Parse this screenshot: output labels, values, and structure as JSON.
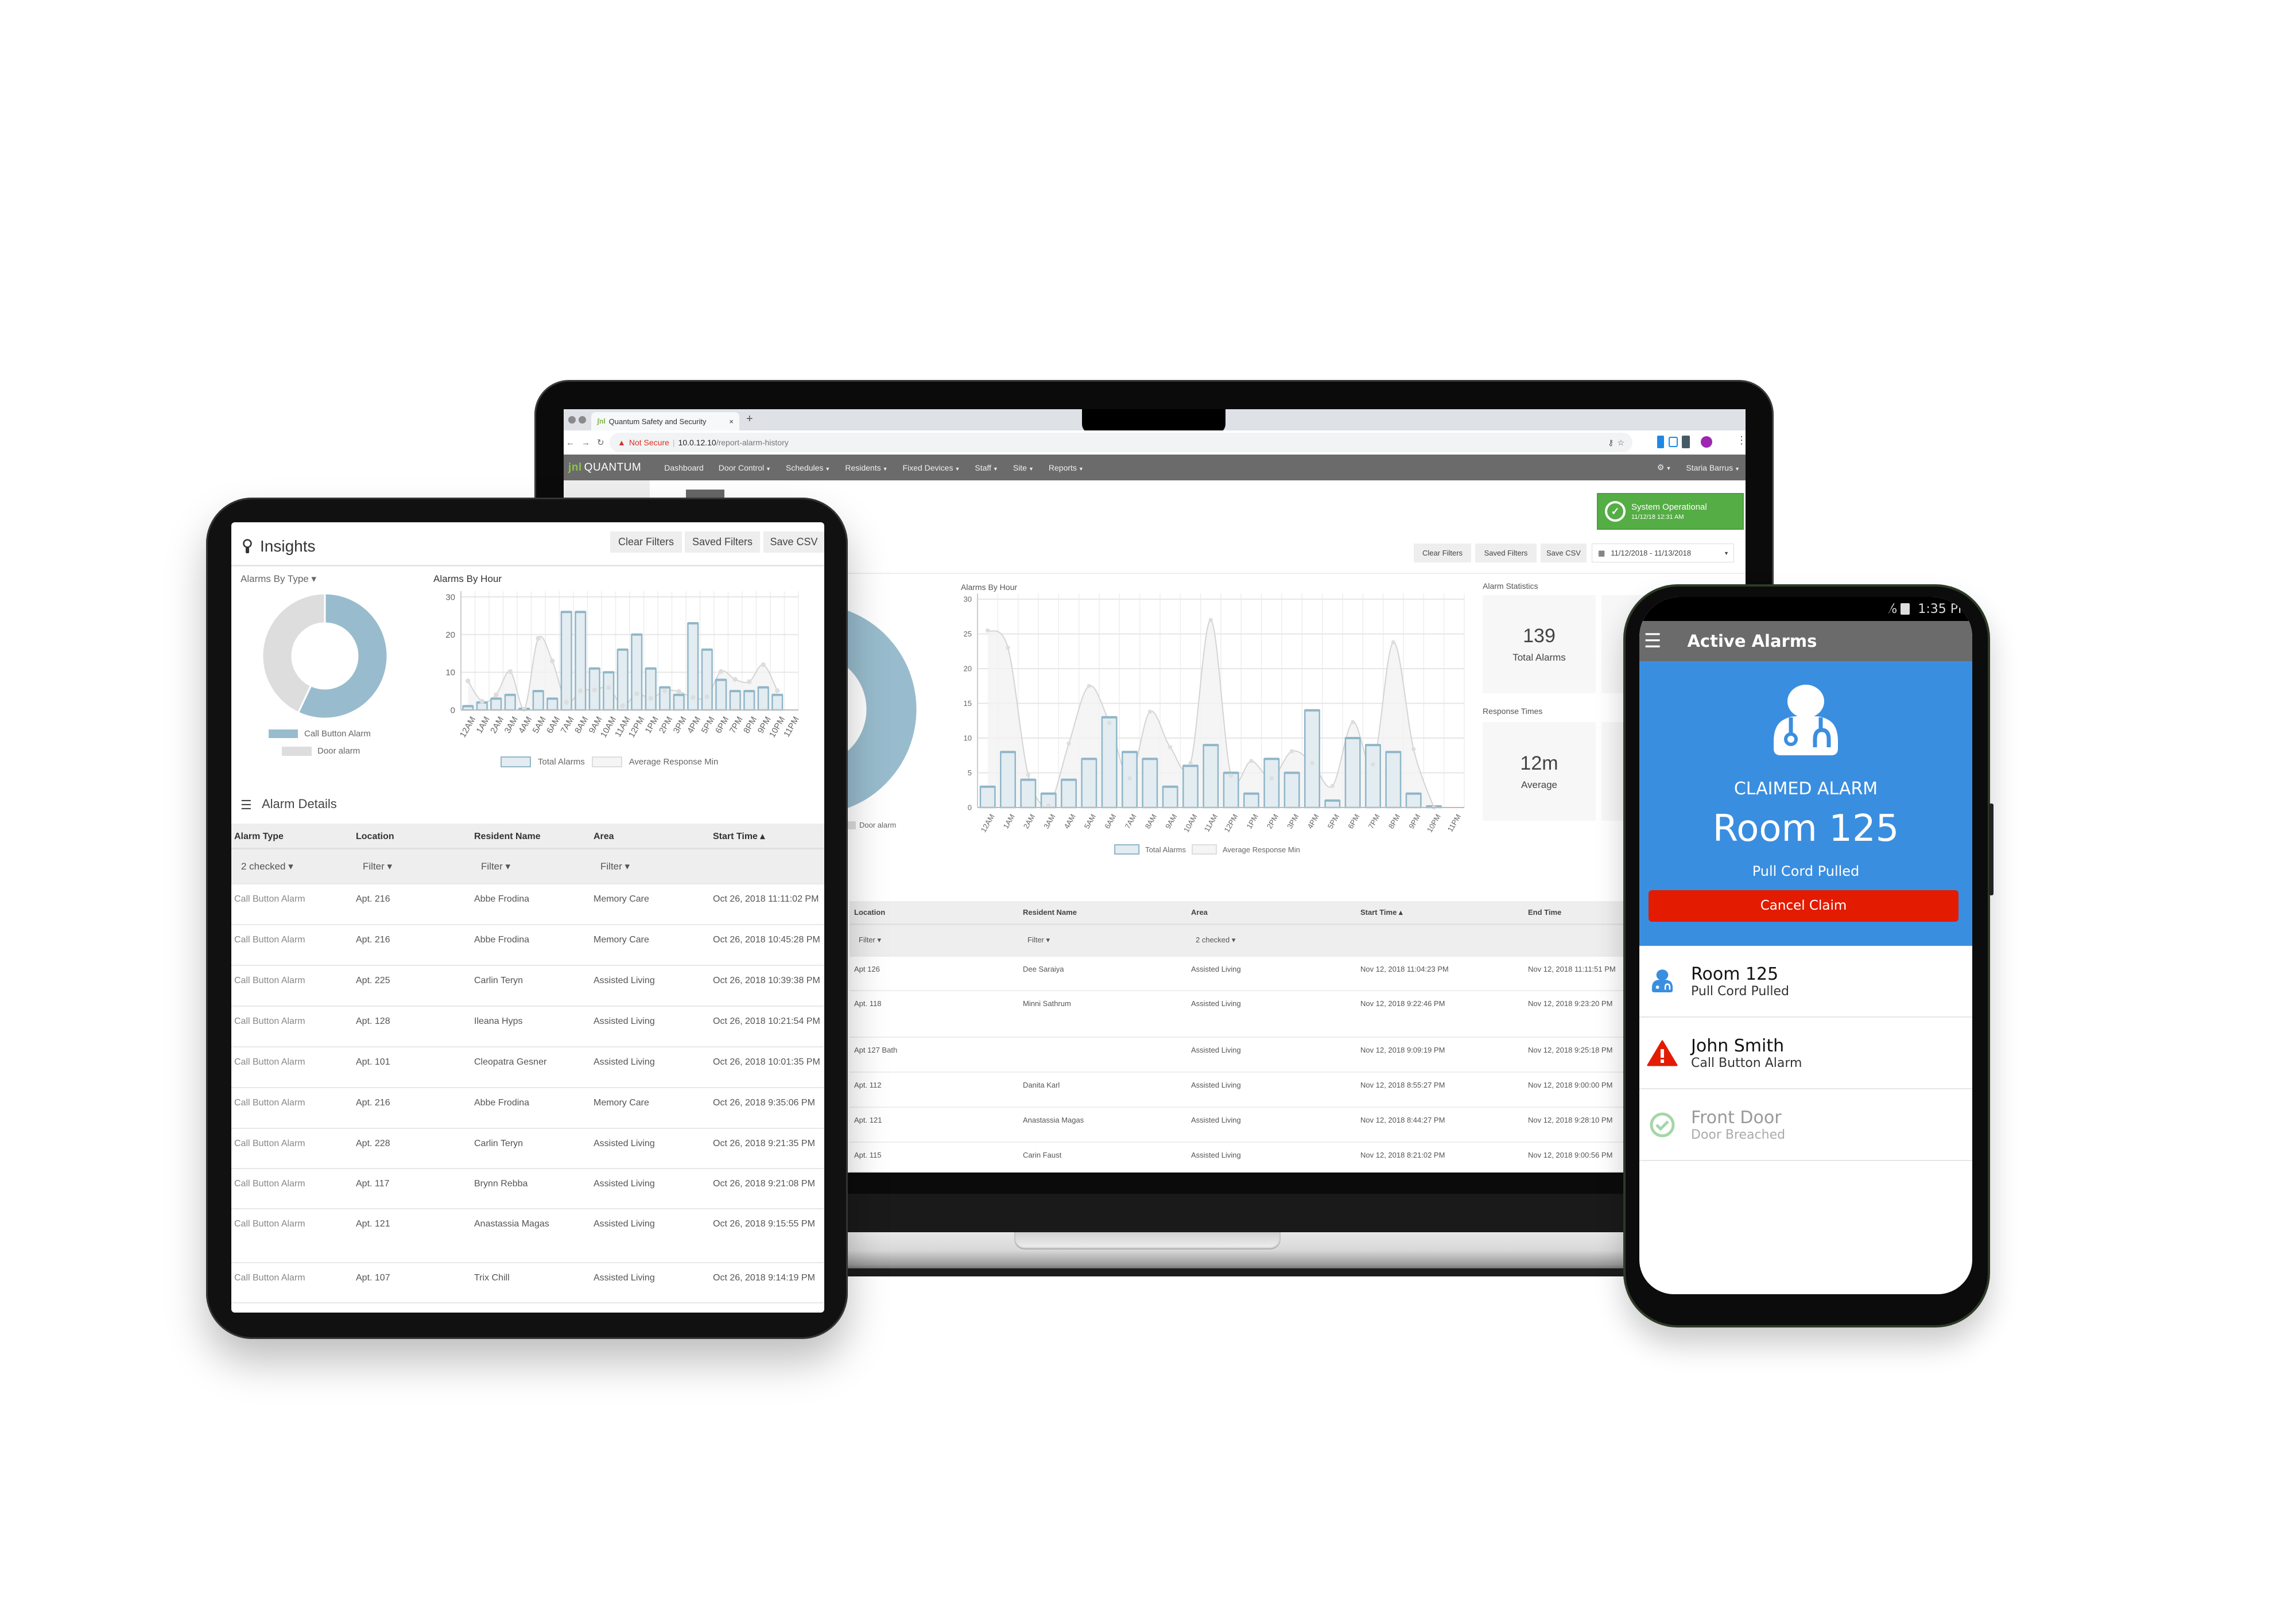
{
  "laptop": {
    "browser": {
      "tab_title": "Quantum Safety and Security",
      "tab_close": "×",
      "new_tab": "+",
      "not_secure": "Not Secure",
      "url_host": "10.0.12.10",
      "url_path": "/report-alarm-history"
    },
    "nav": {
      "logo_mark": "jnl",
      "logo_text": "QUANTUM",
      "items": [
        {
          "label": "Dashboard",
          "menu": false
        },
        {
          "label": "Door Control",
          "menu": true
        },
        {
          "label": "Schedules",
          "menu": true
        },
        {
          "label": "Residents",
          "menu": true
        },
        {
          "label": "Fixed Devices",
          "menu": true
        },
        {
          "label": "Staff",
          "menu": true
        },
        {
          "label": "Site",
          "menu": true
        },
        {
          "label": "Reports",
          "menu": true
        }
      ],
      "user": "Staria Barrus"
    },
    "status": {
      "title": "System Operational",
      "time": "11/12/18 12:31 AM",
      "color": "#55ad45"
    },
    "toolbar": {
      "clear": "Clear Filters",
      "saved": "Saved Filters",
      "save_csv": "Save CSV",
      "date_range": "11/12/2018 - 11/13/2018"
    },
    "donut_legend": "Door alarm",
    "chart_title": "Alarms By Hour",
    "stats": {
      "title": "Alarm Statistics",
      "total_value": "139",
      "total_label": "Total Alarms",
      "response_title": "Response Times",
      "avg_value": "12m",
      "avg_label": "Average"
    },
    "table": {
      "headers": [
        "Location",
        "Resident Name",
        "Area",
        "Start Time ▴",
        "End Time"
      ],
      "filters": [
        "Filter ▾",
        "Filter ▾",
        "2 checked ▾",
        "",
        ""
      ],
      "rows": [
        [
          "Apt 126",
          "Dee Saraiya",
          "Assisted Living",
          "Nov 12, 2018 11:04:23 PM",
          "Nov 12, 2018 11:11:51 PM"
        ],
        [
          "Apt. 118",
          "Minni Sathrum",
          "Assisted Living",
          "Nov 12, 2018 9:22:46 PM",
          "Nov 12, 2018 9:23:20 PM"
        ],
        [
          "Apt 127 Bath",
          "",
          "Assisted Living",
          "Nov 12, 2018 9:09:19 PM",
          "Nov 12, 2018 9:25:18 PM"
        ],
        [
          "Apt. 112",
          "Danita Karl",
          "Assisted Living",
          "Nov 12, 2018 8:55:27 PM",
          "Nov 12, 2018 9:00:00 PM"
        ],
        [
          "Apt. 121",
          "Anastassia Magas",
          "Assisted Living",
          "Nov 12, 2018 8:44:27 PM",
          "Nov 12, 2018 9:28:10 PM"
        ],
        [
          "Apt. 115",
          "Carin Faust",
          "Assisted Living",
          "Nov 12, 2018 8:21:02 PM",
          "Nov 12, 2018 9:00:56 PM"
        ]
      ]
    }
  },
  "tablet": {
    "title": "Insights",
    "toolbar": {
      "clear": "Clear Filters",
      "saved": "Saved Filters",
      "save_csv": "Save CSV"
    },
    "donut_title": "Alarms By Type ▾",
    "chart_title": "Alarms By Hour",
    "details_title": "Alarm Details",
    "table": {
      "headers": [
        "Alarm Type",
        "Location",
        "Resident Name",
        "Area",
        "Start Time ▴"
      ],
      "filters": [
        "2 checked ▾",
        "Filter ▾",
        "Filter ▾",
        "Filter ▾",
        ""
      ],
      "rows": [
        [
          "Call Button Alarm",
          "Apt. 216",
          "Abbe Frodina",
          "Memory Care",
          "Oct 26, 2018 11:11:02 PM"
        ],
        [
          "Call Button Alarm",
          "Apt. 216",
          "Abbe Frodina",
          "Memory Care",
          "Oct 26, 2018 10:45:28 PM"
        ],
        [
          "Call Button Alarm",
          "Apt. 225",
          "Carlin Teryn",
          "Assisted Living",
          "Oct 26, 2018 10:39:38 PM"
        ],
        [
          "Call Button Alarm",
          "Apt. 128",
          "Ileana Hyps",
          "Assisted Living",
          "Oct 26, 2018 10:21:54 PM"
        ],
        [
          "Call Button Alarm",
          "Apt. 101",
          "Cleopatra Gesner",
          "Assisted Living",
          "Oct 26, 2018 10:01:35 PM"
        ],
        [
          "Call Button Alarm",
          "Apt. 216",
          "Abbe Frodina",
          "Memory Care",
          "Oct 26, 2018 9:35:06 PM"
        ],
        [
          "Call Button Alarm",
          "Apt. 228",
          "Carlin Teryn",
          "Assisted Living",
          "Oct 26, 2018 9:21:35 PM"
        ],
        [
          "Call Button Alarm",
          "Apt. 117",
          "Brynn Rebba",
          "Assisted Living",
          "Oct 26, 2018 9:21:08 PM"
        ],
        [
          "Call Button Alarm",
          "Apt. 121",
          "Anastassia Magas",
          "Assisted Living",
          "Oct 26, 2018 9:15:55 PM"
        ],
        [
          "Call Button Alarm",
          "Apt. 107",
          "Trix Chill",
          "Assisted Living",
          "Oct 26, 2018 9:14:19 PM"
        ]
      ]
    }
  },
  "phone": {
    "battery": "65%",
    "time": "1:35 PM",
    "title": "Active Alarms",
    "claimed_label": "CLAIMED ALARM",
    "claimed_room": "Room 125",
    "claimed_reason": "Pull Cord Pulled",
    "cancel_label": "Cancel Claim",
    "colors": {
      "header": "#3a8ee0",
      "cancel": "#e31b00",
      "bar": "#6b6b6b"
    },
    "alarms": [
      {
        "title": "Room 125",
        "subtitle": "Pull Cord Pulled",
        "icon": "user-doctor-icon",
        "color": "#3a8ee0"
      },
      {
        "title": "John Smith",
        "subtitle": "Call Button Alarm",
        "icon": "warning-triangle-icon",
        "color": "#e31b00"
      },
      {
        "title": "Front Door",
        "subtitle": "Door Breached",
        "icon": "check-circle-icon",
        "color": "#a5d6a7"
      }
    ]
  },
  "chart_data": [
    {
      "id": "laptop-alarms-by-hour",
      "type": "bar",
      "title": "Alarms By Hour",
      "categories": [
        "12AM",
        "1AM",
        "2AM",
        "3AM",
        "4AM",
        "5AM",
        "6AM",
        "7AM",
        "8AM",
        "9AM",
        "10AM",
        "11AM",
        "12PM",
        "1PM",
        "2PM",
        "3PM",
        "4PM",
        "5PM",
        "6PM",
        "7PM",
        "8PM",
        "9PM",
        "10PM",
        "11PM"
      ],
      "series": [
        {
          "name": "Total Alarms",
          "type": "bar",
          "values": [
            3,
            8,
            4,
            2,
            4,
            7,
            13,
            8,
            7,
            3,
            6,
            9,
            5,
            2,
            7,
            5,
            14,
            1,
            10,
            9,
            8,
            2,
            0,
            null
          ]
        },
        {
          "name": "Average Response Min",
          "type": "area",
          "values": [
            25.5,
            23,
            4.7,
            0.3,
            9.2,
            17.5,
            12.2,
            4.2,
            13.8,
            8.7,
            6.4,
            27,
            4.6,
            6.7,
            4.2,
            8.1,
            6.4,
            3.1,
            12.3,
            6.2,
            23.8,
            8.4,
            0,
            null
          ]
        }
      ],
      "ylim": [
        0,
        30
      ],
      "yticks": [
        0,
        5,
        10,
        15,
        20,
        25,
        30
      ],
      "grid": true,
      "legend": "bottom",
      "colors": {
        "bar_fill": "#e3ecf0",
        "bar_stroke": "#8fb6c9",
        "area_fill": "#f2f2f2",
        "area_stroke": "#d4d4d4"
      }
    },
    {
      "id": "tablet-alarms-by-hour",
      "type": "bar",
      "title": "Alarms By Hour",
      "categories": [
        "12AM",
        "1AM",
        "2AM",
        "3AM",
        "4AM",
        "5AM",
        "6AM",
        "7AM",
        "8AM",
        "9AM",
        "10AM",
        "11AM",
        "12PM",
        "1PM",
        "2PM",
        "3PM",
        "4PM",
        "5PM",
        "6PM",
        "7PM",
        "8PM",
        "9PM",
        "10PM",
        "11PM"
      ],
      "series": [
        {
          "name": "Total Alarms",
          "type": "bar",
          "values": [
            1,
            2,
            3,
            4,
            0,
            5,
            3,
            26,
            26,
            11,
            10,
            16,
            20,
            11,
            6,
            4,
            23,
            16,
            8,
            5,
            5,
            6,
            4,
            null
          ]
        },
        {
          "name": "Average Response Min",
          "type": "area",
          "values": [
            7.7,
            2.3,
            4,
            10.2,
            0.2,
            19,
            13,
            2,
            5.1,
            5.3,
            5.9,
            1.1,
            4.3,
            3.1,
            5.1,
            4.9,
            3.3,
            3.5,
            10.2,
            8.1,
            7.5,
            12,
            5.1,
            null
          ]
        }
      ],
      "ylim": [
        0,
        30
      ],
      "yticks": [
        0,
        10,
        20,
        30
      ],
      "grid": true,
      "legend": "bottom",
      "colors": {
        "bar_fill": "#e3ecf0",
        "bar_stroke": "#8fb6c9",
        "area_fill": "#f2f2f2",
        "area_stroke": "#d4d4d4"
      }
    },
    {
      "id": "alarms-by-type",
      "type": "pie",
      "donut": true,
      "title": "Alarms By Type",
      "labels": [
        "Call Button Alarm",
        "Door alarm"
      ],
      "values": [
        57,
        43
      ],
      "colors": [
        "#98bccd",
        "#dddddd"
      ],
      "legend": "bottom"
    }
  ]
}
